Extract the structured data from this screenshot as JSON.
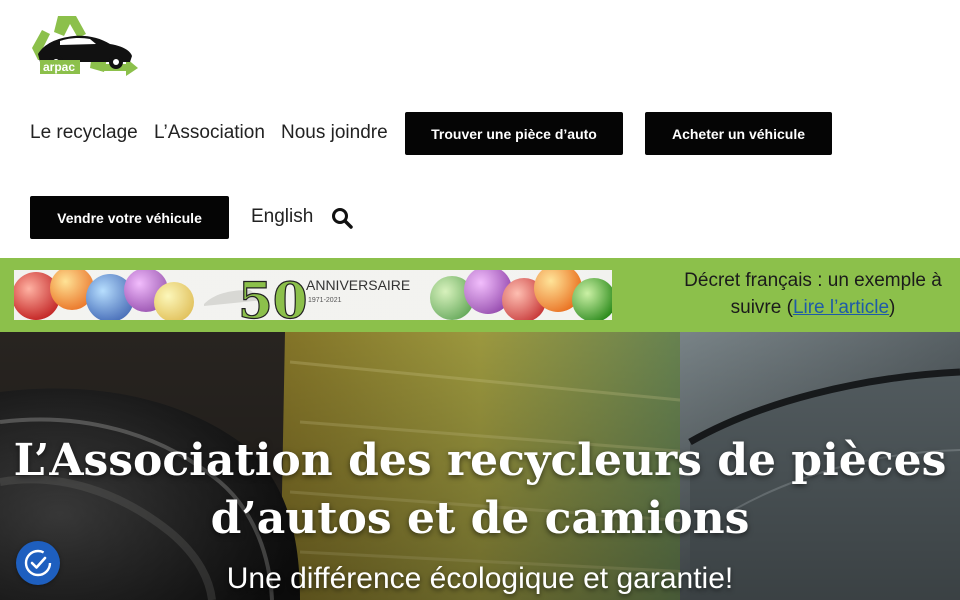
{
  "logo": {
    "text": "arpac"
  },
  "nav": {
    "recycling": "Le recyclage",
    "association": "L’Association",
    "contact": "Nous joindre",
    "find_part": "Trouver une pièce d’auto",
    "buy_vehicle": "Acheter un véhicule",
    "sell_vehicle": "Vendre votre véhicule",
    "language": "English"
  },
  "banner": {
    "anniversary_number": "50",
    "anniversary_word": "ANNIVERSAIRE",
    "anniversary_years": "1971-2021",
    "announcement_prefix": "Décret français : un exemple à suivre (",
    "announcement_link": "Lire l’article",
    "announcement_suffix": ")"
  },
  "hero": {
    "title": "L’Association des recycleurs de pièces d’autos et de camions",
    "subtitle": "Une différence écologique et garantie!"
  },
  "colors": {
    "accent_green": "#8cc04b",
    "button_black": "#050505",
    "link_blue": "#1e5aa8",
    "consent_blue": "#1e5fbf"
  }
}
